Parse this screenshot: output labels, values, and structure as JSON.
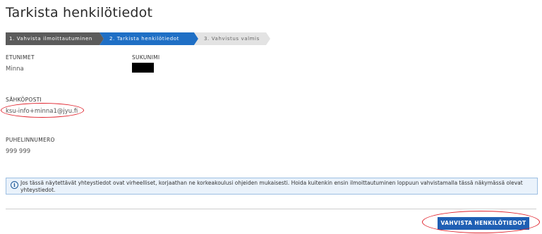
{
  "page": {
    "title": "Tarkista henkilötiedot"
  },
  "steps": [
    {
      "label": "1. Vahvista ilmoittautuminen",
      "state": "done"
    },
    {
      "label": "2. Tarkista henkilötiedot",
      "state": "active"
    },
    {
      "label": "3. Vahvistus valmis",
      "state": "todo"
    }
  ],
  "fields": {
    "first_names": {
      "label": "ETUNIMET",
      "value": "Minna"
    },
    "surname": {
      "label": "SUKUNIMI",
      "value": ""
    },
    "email": {
      "label": "SÄHKÖPOSTI",
      "value": "ksu-info+minna1@jyu.fi"
    },
    "phone": {
      "label": "PUHELINNUMERO",
      "value": "999 999"
    }
  },
  "info": {
    "icon": "info-icon",
    "text": "Jos tässä näytettävät yhteystiedot ovat virheelliset, korjaathan ne korkeakoulusi ohjeiden mukaisesti. Hoida kuitenkin ensin ilmoittautuminen loppuun vahvistamalla tässä näkymässä olevat yhteystiedot."
  },
  "actions": {
    "confirm_label": "VAHVISTA HENKILÖTIEDOT"
  },
  "colors": {
    "accent": "#1f6fc5",
    "button": "#1f5fb4",
    "highlight": "#e0202a"
  }
}
